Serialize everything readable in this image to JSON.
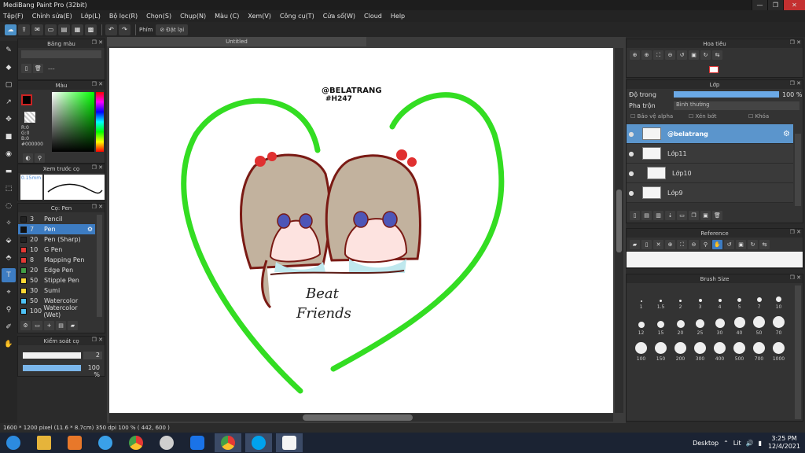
{
  "window": {
    "title": "MediBang Paint Pro (32bit)",
    "controls": [
      "—",
      "❐",
      "✕"
    ]
  },
  "menu": [
    "Tệp(F)",
    "Chỉnh sửa(E)",
    "Lớp(L)",
    "Bộ lọc(R)",
    "Chọn(S)",
    "Chụp(N)",
    "Màu (C)",
    "Xem(V)",
    "Công cụ(T)",
    "Cửa sổ(W)",
    "Cloud",
    "Help"
  ],
  "toolbar": {
    "key_label": "Phím",
    "reset_label": "Đặt lại"
  },
  "document_tab": "Untitled",
  "panels": {
    "palette": {
      "title": "Bảng màu",
      "dots": "---"
    },
    "color": {
      "title": "Màu",
      "r": "R:0",
      "g": "G:0",
      "b": "B:0",
      "hex": "#000000"
    },
    "preview": {
      "title": "Xem trước cọ",
      "size": "0.15mm"
    },
    "brush": {
      "title": "Cọ: Pen"
    },
    "brush_control": {
      "title": "Kiểm soát cọ",
      "value1": "2",
      "value2": "100 %"
    },
    "navigator": {
      "title": "Hoa tiêu"
    },
    "layer": {
      "title": "Lớp",
      "opacity_label": "Độ trong",
      "opacity_value": "100 %",
      "blend_label": "Pha trộn",
      "blend_value": "Bình thường",
      "protect_alpha": "Bảo vệ alpha",
      "clipping": "Xén bớt",
      "lock": "Khóa"
    },
    "reference": {
      "title": "Reference"
    },
    "brush_size": {
      "title": "Brush Size"
    }
  },
  "brushes": [
    {
      "size": "3",
      "name": "Pencil",
      "color": "#222222",
      "selected": false
    },
    {
      "size": "7",
      "name": "Pen",
      "color": "#111111",
      "selected": true
    },
    {
      "size": "20",
      "name": "Pen (Sharp)",
      "color": "#222222",
      "selected": false
    },
    {
      "size": "10",
      "name": "G Pen",
      "color": "#e53935",
      "selected": false
    },
    {
      "size": "8",
      "name": "Mapping Pen",
      "color": "#e53935",
      "selected": false
    },
    {
      "size": "20",
      "name": "Edge Pen",
      "color": "#43a047",
      "selected": false
    },
    {
      "size": "50",
      "name": "Stipple Pen",
      "color": "#fdd835",
      "selected": false
    },
    {
      "size": "30",
      "name": "Sumi",
      "color": "#fdd835",
      "selected": false
    },
    {
      "size": "50",
      "name": "Watercolor",
      "color": "#4fc3f7",
      "selected": false
    },
    {
      "size": "100",
      "name": "Watercolor (Wet)",
      "color": "#4fc3f7",
      "selected": false
    }
  ],
  "layers": [
    {
      "name": "@belatrang",
      "selected": true
    },
    {
      "name": "Lớp11",
      "selected": false
    },
    {
      "name": "Lớp10",
      "selected": false
    },
    {
      "name": "Lớp9",
      "selected": false
    }
  ],
  "brush_sizes": [
    "1",
    "1.5",
    "2",
    "3",
    "4",
    "5",
    "7",
    "10",
    "12",
    "15",
    "20",
    "25",
    "30",
    "40",
    "50",
    "70",
    "100",
    "150",
    "200",
    "300",
    "400",
    "500",
    "700",
    "1000"
  ],
  "artwork": {
    "handle": "@BELATRANG",
    "tag": "#H247",
    "caption1": "Beat",
    "caption2": "Friends"
  },
  "status": {
    "dimensions": "1600 * 1200 pixel",
    "physical": "(11.6 * 8.7cm)",
    "dpi": "350 dpi",
    "zoom": "100 %",
    "coords": "( 442, 600 )"
  },
  "taskbar": {
    "desktop": "Desktop",
    "lang": "Lit",
    "time": "3:25 PM",
    "date": "12/4/2021"
  },
  "colors": {
    "accent": "#3d7cc2",
    "heart": "#33dd22",
    "outline": "#7a1a14"
  }
}
